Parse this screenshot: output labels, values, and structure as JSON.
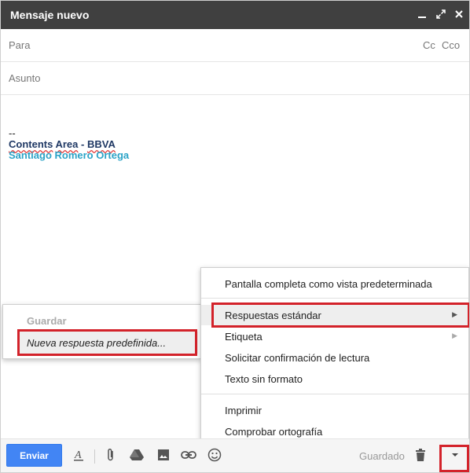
{
  "window": {
    "title": "Mensaje nuevo"
  },
  "fields": {
    "to_label": "Para",
    "cc_label": "Cc",
    "bcc_label": "Cco",
    "subject_label": "Asunto"
  },
  "body": {
    "dash": "--",
    "sig_contents": "Contents",
    "sig_area": "Area",
    "sig_sep": " - ",
    "sig_bbva": "BBVA",
    "sig_name": "Santiago Romero Ortega"
  },
  "submenu": {
    "save": "Guardar",
    "new_canned": "Nueva respuesta predefinida..."
  },
  "menu": {
    "fullscreen_default": "Pantalla completa como vista predeterminada",
    "canned_responses": "Respuestas estándar",
    "label": "Etiqueta",
    "read_receipt": "Solicitar confirmación de lectura",
    "plain_text": "Texto sin formato",
    "print": "Imprimir",
    "spellcheck": "Comprobar ortografía"
  },
  "toolbar": {
    "send": "Enviar",
    "saved": "Guardado"
  },
  "icons": [
    "minimize-icon",
    "expand-icon",
    "close-icon",
    "format-text-icon",
    "attach-icon",
    "drive-icon",
    "photo-icon",
    "link-icon",
    "emoji-icon",
    "trash-icon",
    "more-options-icon"
  ],
  "colors": {
    "titlebar": "#404040",
    "send": "#4285f4",
    "highlight": "#d3222a",
    "signature_blue": "#1f3864",
    "signature_cyan": "#2ba3c7"
  }
}
